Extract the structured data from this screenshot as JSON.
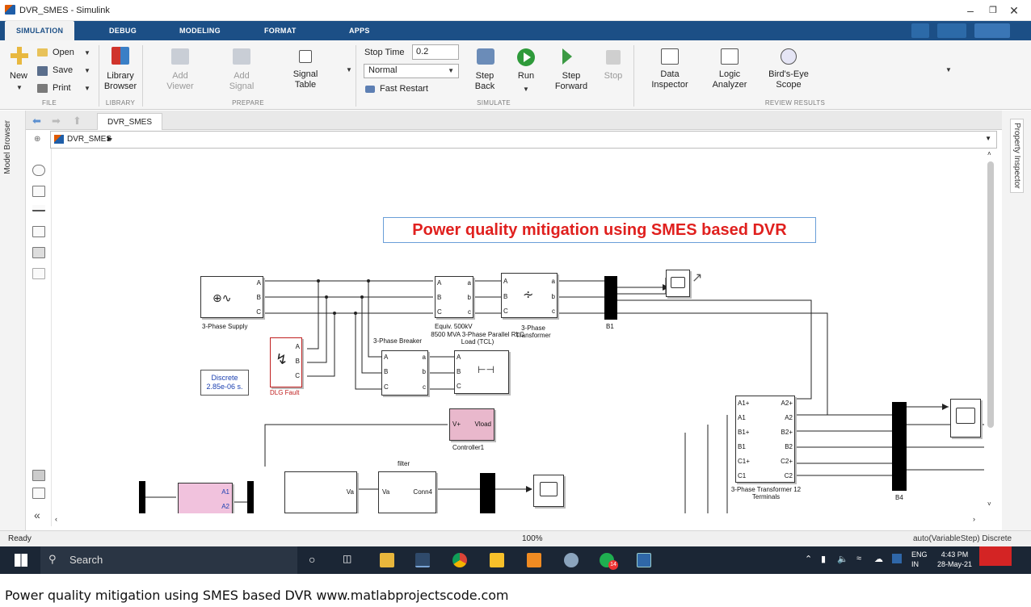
{
  "window": {
    "title": "DVR_SMES - Simulink"
  },
  "tabs": [
    "SIMULATION",
    "DEBUG",
    "MODELING",
    "FORMAT",
    "APPS"
  ],
  "ribbon": {
    "new": "New",
    "open": "Open",
    "save": "Save",
    "print": "Print",
    "file_section": "FILE",
    "library_browser": "Library Browser",
    "library_section": "LIBRARY",
    "add_viewer": "Add Viewer",
    "add_signal": "Add Signal",
    "signal_table": "Signal Table",
    "prepare_section": "PREPARE",
    "stop_time_label": "Stop Time",
    "stop_time_value": "0.2",
    "mode_value": "Normal",
    "fast_restart": "Fast Restart",
    "step_back": "Step Back",
    "run": "Run",
    "step_forward": "Step Forward",
    "stop": "Stop",
    "simulate_section": "SIMULATE",
    "data_inspector": "Data Inspector",
    "logic_analyzer": "Logic Analyzer",
    "birds_eye": "Bird's-Eye Scope",
    "review_section": "REVIEW RESULTS"
  },
  "side": {
    "model_browser": "Model Browser",
    "property_inspector": "Property Inspector"
  },
  "editor": {
    "tab": "DVR_SMES",
    "breadcrumb": "DVR_SMES"
  },
  "diagram": {
    "title": "Power quality mitigation using SMES based DVR",
    "supply": "3-Phase Supply",
    "equiv": "Equiv. 500kV",
    "load": "8500 MVA 3-Phase Parallel RLC Load (TCL)",
    "transformer": "3-Phase Transformer",
    "breaker": "3-Phase Breaker",
    "b1": "B1",
    "b4": "B4",
    "fault": "DLG Fault",
    "discrete": "Discrete",
    "discrete_ts": "2.85e-06 s.",
    "controller": "Controller1",
    "ctrl_in": "V+",
    "ctrl_out": "Vload",
    "filter": "filter",
    "filter_in": "Va",
    "filter_out": "Conn4",
    "va": "Va",
    "t12": "3-Phase Transformer 12 Terminals"
  },
  "status": {
    "left": "Ready",
    "zoom": "100%",
    "solver": "auto(VariableStep) Discrete"
  },
  "taskbar": {
    "search": "Search",
    "lang1": "ENG",
    "lang2": "IN",
    "time": "4:43 PM",
    "date": "28-May-21",
    "badge": "14"
  },
  "caption": "Power quality mitigation using SMES based DVR www.matlabprojectscode.com"
}
